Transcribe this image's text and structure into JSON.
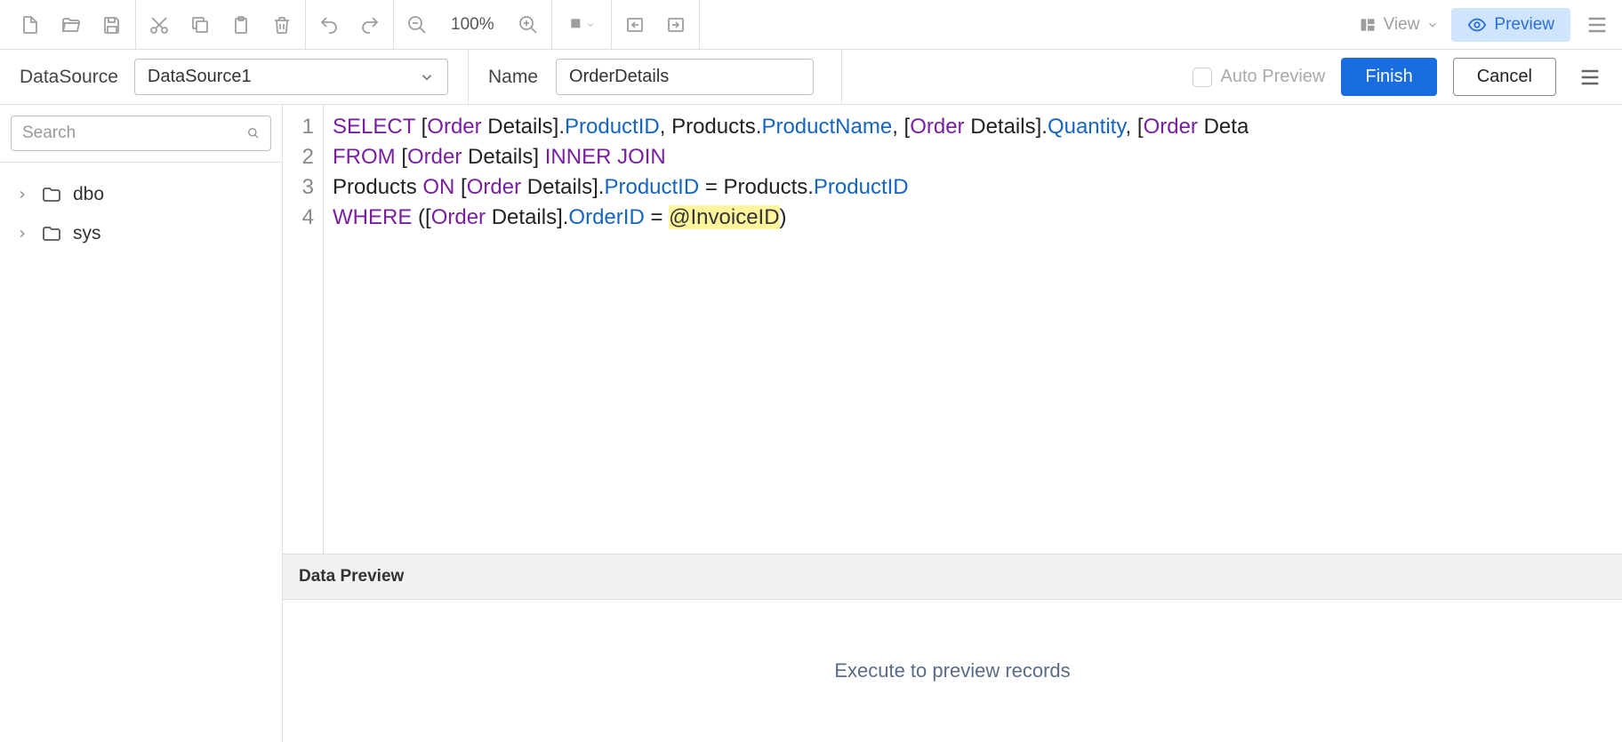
{
  "toolbar": {
    "zoom_label": "100%",
    "view_label": "View",
    "preview_label": "Preview"
  },
  "config": {
    "datasource_label": "DataSource",
    "datasource_value": "DataSource1",
    "name_label": "Name",
    "name_value": "OrderDetails",
    "auto_preview_label": "Auto Preview",
    "finish_label": "Finish",
    "cancel_label": "Cancel"
  },
  "sidebar": {
    "search_placeholder": "Search",
    "items": [
      {
        "label": "dbo"
      },
      {
        "label": "sys"
      }
    ]
  },
  "editor": {
    "lines": [
      "1",
      "2",
      "3",
      "4"
    ],
    "code": {
      "l1": {
        "kw": "SELECT",
        "pad": "      ",
        "b1": "[",
        "o1": "Order",
        "rest1": " Details].",
        "c1": "ProductID",
        "t1": ", Products.",
        "c2": "ProductName",
        "t2": ", [",
        "o2": "Order",
        "rest2": " Details].",
        "c3": "Quantity",
        "t3": ", [",
        "o3": "Order",
        "rest3": " Deta"
      },
      "l2": {
        "kw": "FROM",
        "pad": "        ",
        "b1": "[",
        "o1": "Order",
        "rest1": " Details] ",
        "j1": "INNER",
        "sp": " ",
        "j2": "JOIN"
      },
      "l3": {
        "t1": "Products ",
        "kw": "ON",
        "t2": " [",
        "o1": "Order",
        "rest1": " Details].",
        "c1": "ProductID",
        "t3": " = Products.",
        "c2": "ProductID"
      },
      "l4": {
        "kw": "WHERE",
        "pad": "      ",
        "t1": "([",
        "o1": "Order",
        "rest1": " Details].",
        "c1": "OrderID",
        "t2": " = ",
        "hl": "@InvoiceID",
        ")": ")"
      }
    }
  },
  "preview": {
    "header": "Data Preview",
    "empty_text": "Execute to preview records"
  }
}
